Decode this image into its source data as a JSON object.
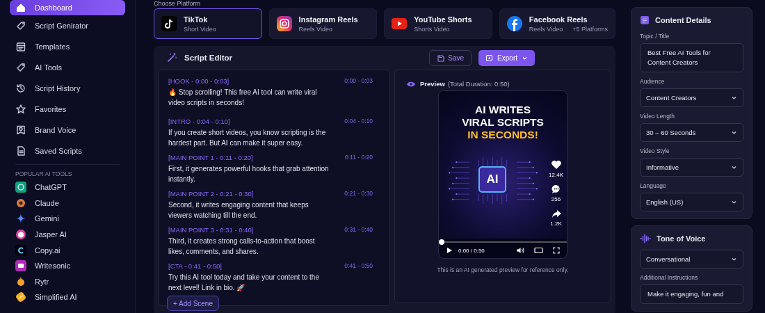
{
  "sidebar": {
    "nav": [
      {
        "label": "Dashboard",
        "selected": true
      },
      {
        "label": "Script Genirator",
        "selected": false
      },
      {
        "label": "Templates",
        "selected": false
      },
      {
        "label": "AI Tools",
        "selected": false
      },
      {
        "label": "Script History",
        "selected": false
      },
      {
        "label": "Favorites",
        "selected": false
      },
      {
        "label": "Brand Voice",
        "selected": false
      },
      {
        "label": "Saved Scripts",
        "selected": false
      }
    ],
    "tools_heading": "POPULAR AI TOOLS",
    "tools": [
      {
        "label": "ChatGPT"
      },
      {
        "label": "Claude"
      },
      {
        "label": "Gemini"
      },
      {
        "label": "Jasper AI"
      },
      {
        "label": "Copy.ai"
      },
      {
        "label": "Writesonic"
      },
      {
        "label": "Rytr"
      },
      {
        "label": "Simplified AI"
      }
    ]
  },
  "platform_heading": "Choose Platform",
  "platforms": [
    {
      "name": "TikTok",
      "subtitle": "Short Video",
      "selected": true
    },
    {
      "name": "Instagram Reels",
      "subtitle": "Reels Video",
      "selected": false
    },
    {
      "name": "YouTube Shorts",
      "subtitle": "Shorts Video",
      "selected": false
    },
    {
      "name": "Facebook Reels",
      "subtitle": "Reels Video",
      "extra": "+5 Platforms",
      "selected": false
    }
  ],
  "editor": {
    "title": "Script Editor",
    "save": "Save",
    "export": "Export",
    "scenes": [
      {
        "heading": "[HOOK - 0:00 - 0:03]",
        "time": "0:00 - 0:03",
        "text": "🔥 Stop scrolling! This free AI tool can write viral video scripts in seconds!"
      },
      {
        "heading": "[INTRO - 0:04 - 0:10]",
        "time": "0:04 - 0:10",
        "text": "If you create short videos, you know scripting is the hardest part. But AI can make it super easy."
      },
      {
        "heading": "[MAIN POINT 1 - 0:11 - 0:20]",
        "time": "0:11 - 0:20",
        "text": "First, it generates powerful hooks that grab attention instantly."
      },
      {
        "heading": "[MAIN POINT 2 - 0:21 - 0:30]",
        "time": "0:21 - 0:30",
        "text": "Second, it writes engaging content that keeps viewers watching till the end."
      },
      {
        "heading": "[MAIN POINT 3 - 0:31 - 0:40]",
        "time": "0:31 - 0:40",
        "text": "Third, it creates strong calls-to-action that boost likes, comments, and shares."
      },
      {
        "heading": "[CTA - 0:41 - 0:50]",
        "time": "0:41 - 0:50",
        "text": "Try this AI tool today and take your content to the next level! Link in bio. 🚀"
      }
    ],
    "add_scene": "+ Add Scene"
  },
  "preview": {
    "label": "Preview",
    "duration": "(Total Duration:  0:50)",
    "headline": [
      {
        "text": "AI WRITES",
        "highlight": false
      },
      {
        "text": "VIRAL SCRIPTS",
        "highlight": false
      },
      {
        "text": "IN SECONDS!",
        "highlight": true
      }
    ],
    "chip": "AI",
    "stats": [
      {
        "kind": "like",
        "count": "12.4K"
      },
      {
        "kind": "comment",
        "count": "256"
      },
      {
        "kind": "share",
        "count": "1.2K"
      }
    ],
    "progress": {
      "level": 0
    },
    "time": "0:00 / 0:50",
    "note": "This is an AI generated preview for reference only."
  },
  "content_details": {
    "title": "Content Details",
    "fields": [
      {
        "label": "Topic / Title",
        "kind": "textarea",
        "value": "Best Free AI Tools for Content Creators"
      },
      {
        "label": "Audience",
        "kind": "select",
        "value": "Content Creators"
      },
      {
        "label": "Video Length",
        "kind": "select",
        "value": "30 – 60 Seconds"
      },
      {
        "label": "Video Style",
        "kind": "select",
        "value": "Informative"
      },
      {
        "label": "Language",
        "kind": "select",
        "value": "English (US)"
      }
    ]
  },
  "tone": {
    "title": "Tone of Voice",
    "fields": [
      {
        "kind": "select",
        "value": "Conversational"
      },
      {
        "label": "Additional Instructions",
        "kind": "textarea",
        "value": "Make it engaging, fun and"
      }
    ]
  }
}
